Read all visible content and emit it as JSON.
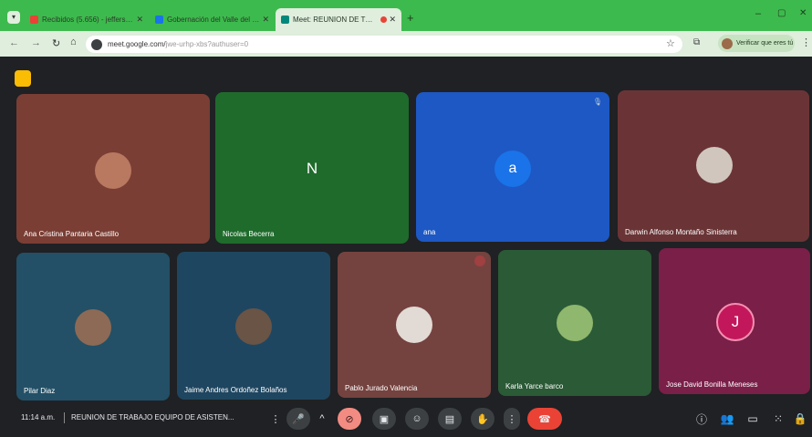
{
  "browser": {
    "tabs": [
      {
        "label": "Recibidos (5.656) - jefferson@...",
        "color": "#ea4335"
      },
      {
        "label": "Gobernación del Valle del Cauca",
        "color": "#1a73e8"
      },
      {
        "label": "Meet: REUNION DE TRAB...",
        "color": "#00897b"
      }
    ],
    "url": "meet.google.com/",
    "url_rest": "jwe-urhp-xbs?authuser=0",
    "profile_label": "Verificar que eres tú"
  },
  "meet": {
    "participants": [
      {
        "name": "Ana Cristina Pantaria Castillo",
        "bg": "#7a3e34",
        "kind": "photo",
        "photo_color": "#b97860"
      },
      {
        "name": "Nicolas Becerra",
        "bg": "#1f6b2c",
        "kind": "letter",
        "initial": "N",
        "avatar_color": "#1f6b2c"
      },
      {
        "name": "ana",
        "bg": "#1d58c4",
        "kind": "letter",
        "initial": "a",
        "avatar_color": "#1a73e8"
      },
      {
        "name": "Darwin Alfonso Montaño Sinisterra",
        "bg": "#6a3436",
        "kind": "photo",
        "photo_color": "#d0c6bd"
      },
      {
        "name": "Pilar Diaz",
        "bg": "#235066",
        "kind": "photo",
        "photo_color": "#8d6a55"
      },
      {
        "name": "Jaime Andres Ordoñez Bolaños",
        "bg": "#1f4660",
        "kind": "photo",
        "photo_color": "#6a5445"
      },
      {
        "name": "Pablo Jurado Valencia",
        "bg": "#74433f",
        "kind": "photo",
        "photo_color": "#e2dad5"
      },
      {
        "name": "Karla Yarce barco",
        "bg": "#2b5a36",
        "kind": "photo",
        "photo_color": "#8fb76d"
      },
      {
        "name": "Jose David Bonilla Meneses",
        "bg": "#7a1f48",
        "kind": "letter",
        "initial": "J",
        "avatar_color": "#c2185b"
      }
    ],
    "time": "11:14 a.m.",
    "meeting_title": "REUNION DE TRABAJO EQUIPO DE ASISTEN...",
    "controls": [
      "mic",
      "camera-off",
      "present",
      "emoji",
      "captions",
      "raise-hand",
      "more",
      "leave"
    ],
    "right_icons": [
      "info",
      "people",
      "chat",
      "activities",
      "host-controls"
    ],
    "leave_color": "#ea4335"
  }
}
